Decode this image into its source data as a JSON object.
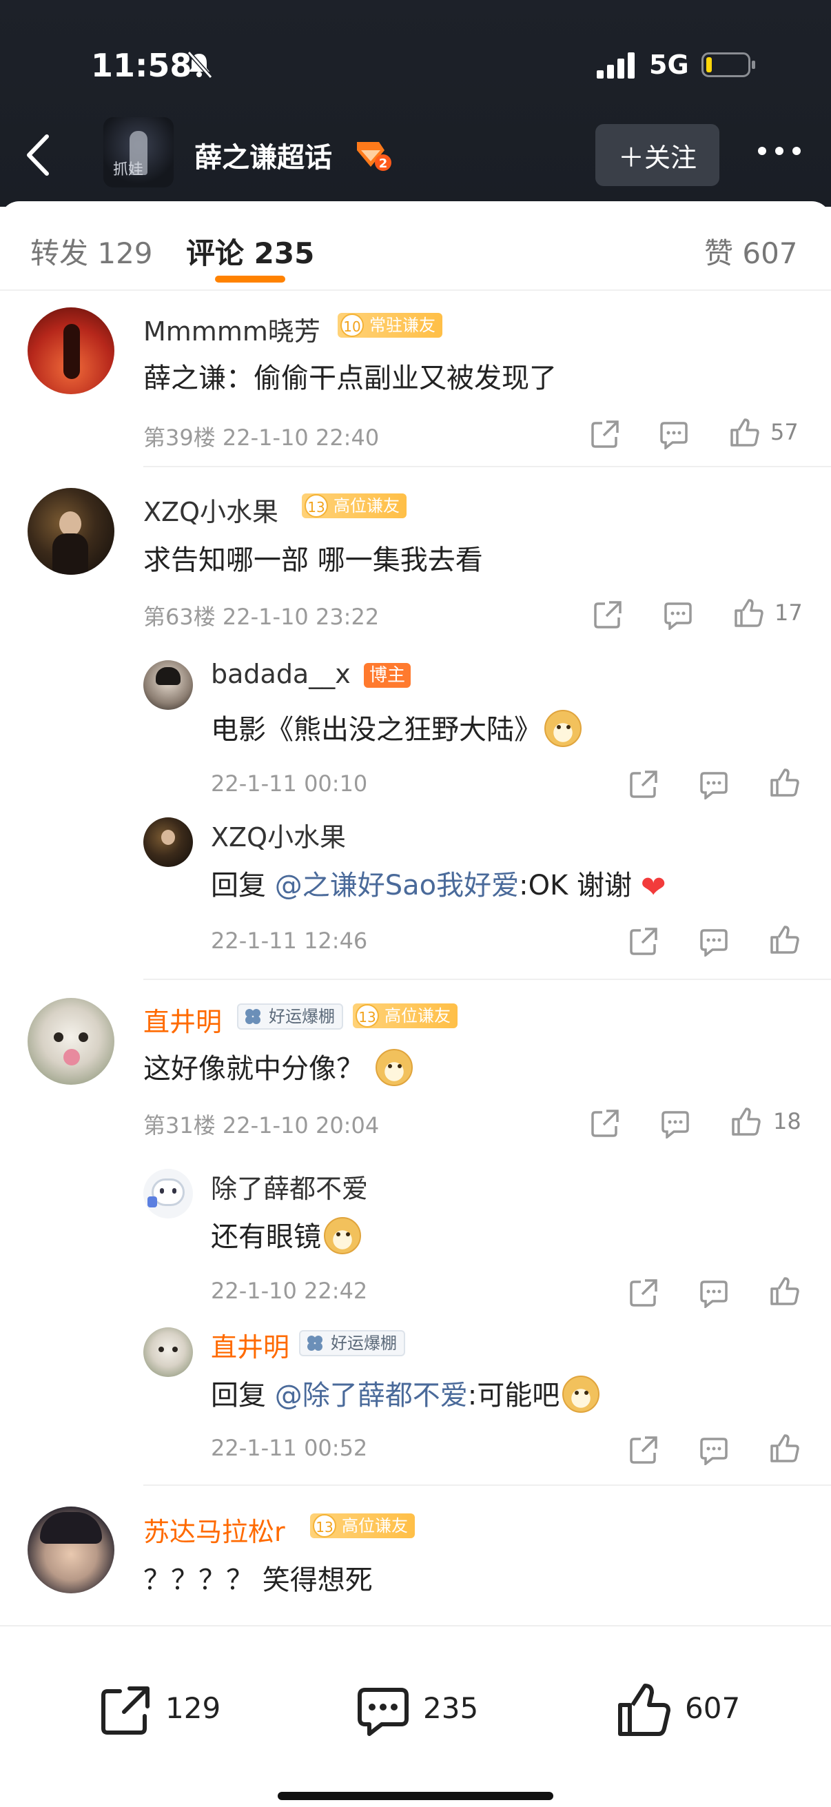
{
  "status": {
    "time": "11:58",
    "network": "5G"
  },
  "header": {
    "topic_title": "薛之谦超话",
    "cover_text": "抓娃",
    "follow_label": "＋关注"
  },
  "tabs": {
    "repost": "转发 129",
    "comment": "评论 235",
    "like": "赞 607"
  },
  "comments": [
    {
      "user": "Mmmmm晓芳",
      "level": "10",
      "level_label": "常驻谦友",
      "text": "薛之谦：偷偷干点副业又被发现了",
      "meta": "第39楼 22-1-10 22:40",
      "likes": "57"
    },
    {
      "user": "XZQ小水果",
      "level": "13",
      "level_label": "高位谦友",
      "text": "求告知哪一部 哪一集我去看",
      "meta": "第63楼 22-1-10 23:22",
      "likes": "17",
      "replies": [
        {
          "user": "badada__x",
          "tag": "博主",
          "text": "电影《熊出没之狂野大陆》",
          "meta": "22-1-11 00:10"
        },
        {
          "user": "XZQ小水果",
          "text_prefix": "回复 ",
          "mention": "@之谦好Sao我好爱",
          "text_suffix": ":OK 谢谢",
          "meta": "22-1-11 12:46"
        }
      ]
    },
    {
      "user": "直井明",
      "luck_label": "好运爆棚",
      "level": "13",
      "level_label": "高位谦友",
      "text": "这好像就中分像？",
      "meta": "第31楼 22-1-10 20:04",
      "likes": "18",
      "replies": [
        {
          "user": "除了薛都不爱",
          "text": "还有眼镜",
          "meta": "22-1-10 22:42"
        },
        {
          "user": "直井明",
          "luck_label": "好运爆棚",
          "text_prefix": "回复 ",
          "mention": "@除了薛都不爱",
          "text_suffix": ":可能吧",
          "meta": "22-1-11 00:52"
        }
      ]
    },
    {
      "user": "苏达马拉松r",
      "level": "13",
      "level_label": "高位谦友",
      "text": "？？？？ 笑得想死"
    }
  ],
  "bottom_bar": {
    "repost_count": "129",
    "comment_count": "235",
    "like_count": "607"
  },
  "colors": {
    "accent": "#ff8200",
    "header_bg": "#1d2129",
    "mention": "#4a6a9a"
  }
}
